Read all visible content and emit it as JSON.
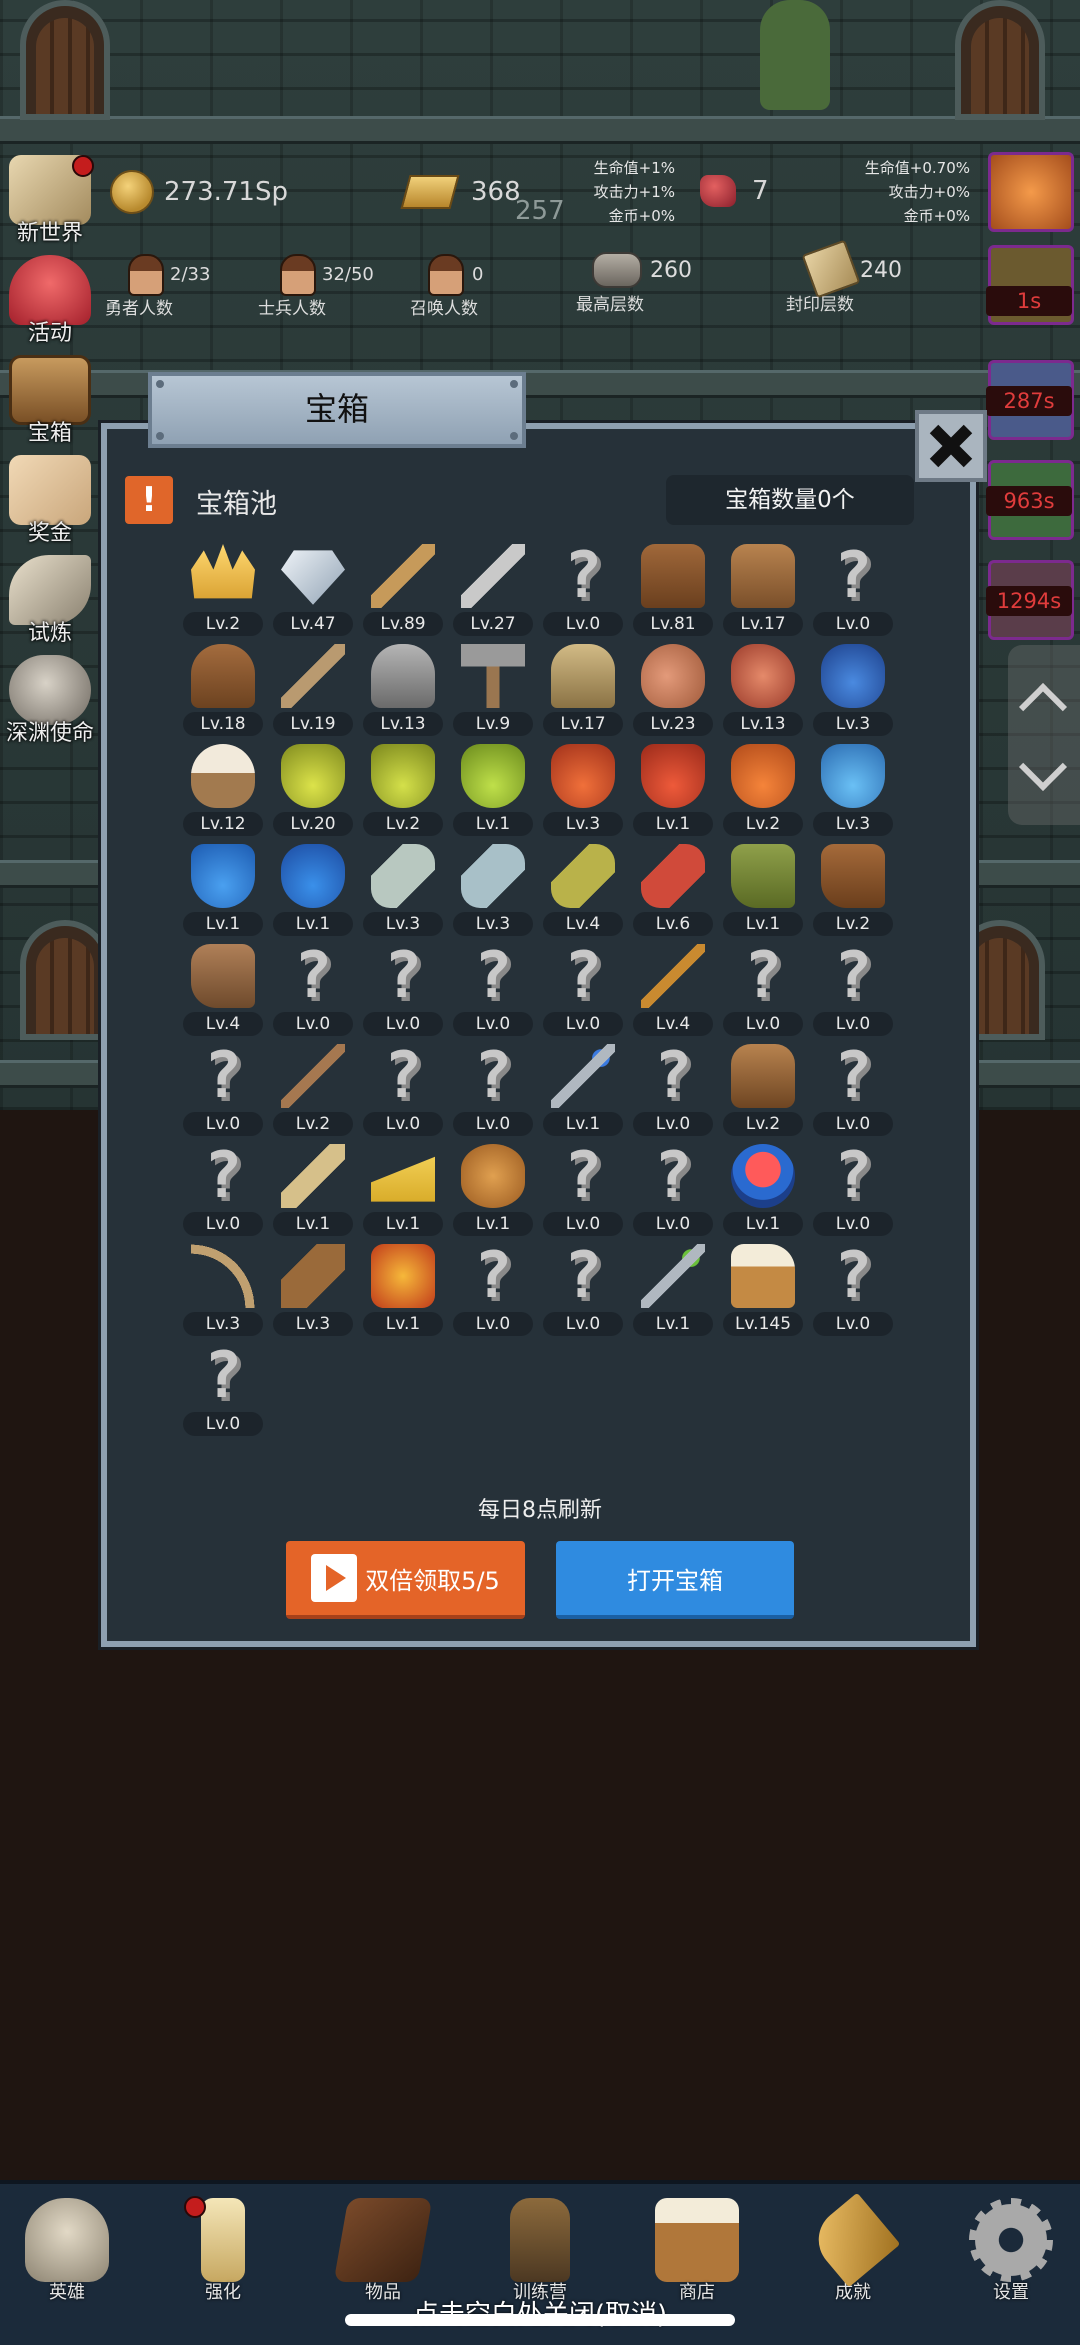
{
  "colors": {
    "modal_bg": "#263139",
    "modal_border": "#8ea0b0",
    "orange_button": "#e46428",
    "blue_button": "#2f8be0",
    "timer_text": "#e03c3c"
  },
  "hud": {
    "gold": "273.71Sp",
    "bars": "368",
    "bars_sub": "257",
    "gems": "7",
    "bonus_left": [
      "生命值+1%",
      "攻击力+1%",
      "金币+0%"
    ],
    "bonus_right": [
      "生命值+0.70%",
      "攻击力+0%",
      "金币+0%"
    ],
    "heroes": {
      "value": "2/33",
      "label": "勇者人数"
    },
    "soldiers": {
      "value": "32/50",
      "label": "士兵人数"
    },
    "summons": {
      "value": "0",
      "label": "召唤人数"
    },
    "max_floor": {
      "value": "260",
      "label": "最高层数"
    },
    "sealed_floor": {
      "value": "240",
      "label": "封印层数"
    }
  },
  "side_menu": [
    {
      "label": "新世界",
      "icon": "map-icon"
    },
    {
      "label": "活动",
      "icon": "heart-icon"
    },
    {
      "label": "宝箱",
      "icon": "chest-icon"
    },
    {
      "label": "奖金",
      "icon": "envelope-icon"
    },
    {
      "label": "试炼",
      "icon": "feather-icon"
    },
    {
      "label": "深渊使命",
      "icon": "orb-icon"
    }
  ],
  "right_timers": [
    "1s",
    "287s",
    "963s",
    "1294s"
  ],
  "modal": {
    "title": "宝箱",
    "warning": "!",
    "pool_title": "宝箱池",
    "chest_count": "宝箱数量0个",
    "refresh_note": "每日8点刷新",
    "double_button": "双倍领取5/5",
    "open_button": "打开宝箱"
  },
  "items": [
    {
      "icon": "crown-icon",
      "level": "Lv.2"
    },
    {
      "icon": "diamond-icon",
      "level": "Lv.47"
    },
    {
      "icon": "bronze-sword-icon",
      "level": "Lv.89"
    },
    {
      "icon": "silver-sword-icon",
      "level": "Lv.27"
    },
    {
      "icon": "unknown-icon",
      "level": "Lv.0"
    },
    {
      "icon": "leather-armor-icon",
      "level": "Lv.81"
    },
    {
      "icon": "backpack-icon",
      "level": "Lv.17"
    },
    {
      "icon": "unknown-icon",
      "level": "Lv.0"
    },
    {
      "icon": "leather-helmet-icon",
      "level": "Lv.18"
    },
    {
      "icon": "dagger-icon",
      "level": "Lv.19"
    },
    {
      "icon": "knight-helmet-icon",
      "level": "Lv.13"
    },
    {
      "icon": "hammer-icon",
      "level": "Lv.9"
    },
    {
      "icon": "great-helm-icon",
      "level": "Lv.17"
    },
    {
      "icon": "ham-icon",
      "level": "Lv.23"
    },
    {
      "icon": "steak-icon",
      "level": "Lv.13"
    },
    {
      "icon": "blue-pot-icon",
      "level": "Lv.3"
    },
    {
      "icon": "flour-bowl-icon",
      "level": "Lv.12"
    },
    {
      "icon": "yellow-potion-icon",
      "level": "Lv.20"
    },
    {
      "icon": "yellow-flask-icon",
      "level": "Lv.2"
    },
    {
      "icon": "green-potion-icon",
      "level": "Lv.1"
    },
    {
      "icon": "red-potion-icon",
      "level": "Lv.3"
    },
    {
      "icon": "red-flask-icon",
      "level": "Lv.1"
    },
    {
      "icon": "orange-potion-icon",
      "level": "Lv.2"
    },
    {
      "icon": "blue-vial-icon",
      "level": "Lv.3"
    },
    {
      "icon": "blue-flask-icon",
      "level": "Lv.1"
    },
    {
      "icon": "blue-potion-icon",
      "level": "Lv.1"
    },
    {
      "icon": "grey-vial-icon",
      "level": "Lv.3"
    },
    {
      "icon": "silver-vial-icon",
      "level": "Lv.3"
    },
    {
      "icon": "olive-bottle-icon",
      "level": "Lv.4"
    },
    {
      "icon": "red-bottle-icon",
      "level": "Lv.6"
    },
    {
      "icon": "winged-boot-icon",
      "level": "Lv.1"
    },
    {
      "icon": "leather-boot-icon",
      "level": "Lv.2"
    },
    {
      "icon": "leather-shoe-icon",
      "level": "Lv.4"
    },
    {
      "icon": "unknown-icon",
      "level": "Lv.0"
    },
    {
      "icon": "unknown-icon",
      "level": "Lv.0"
    },
    {
      "icon": "unknown-icon",
      "level": "Lv.0"
    },
    {
      "icon": "unknown-icon",
      "level": "Lv.0"
    },
    {
      "icon": "torch-staff-icon",
      "level": "Lv.4"
    },
    {
      "icon": "unknown-icon",
      "level": "Lv.0"
    },
    {
      "icon": "unknown-icon",
      "level": "Lv.0"
    },
    {
      "icon": "unknown-icon",
      "level": "Lv.0"
    },
    {
      "icon": "wooden-staff-icon",
      "level": "Lv.2"
    },
    {
      "icon": "unknown-icon",
      "level": "Lv.0"
    },
    {
      "icon": "unknown-icon",
      "level": "Lv.0"
    },
    {
      "icon": "blue-wand-icon",
      "level": "Lv.1"
    },
    {
      "icon": "unknown-icon",
      "level": "Lv.0"
    },
    {
      "icon": "big-backpack-icon",
      "level": "Lv.2"
    },
    {
      "icon": "unknown-icon",
      "level": "Lv.0"
    },
    {
      "icon": "unknown-icon",
      "level": "Lv.0"
    },
    {
      "icon": "club-icon",
      "level": "Lv.1"
    },
    {
      "icon": "cheese-icon",
      "level": "Lv.1"
    },
    {
      "icon": "pie-icon",
      "level": "Lv.1"
    },
    {
      "icon": "unknown-icon",
      "level": "Lv.0"
    },
    {
      "icon": "unknown-icon",
      "level": "Lv.0"
    },
    {
      "icon": "red-orb-icon",
      "level": "Lv.1"
    },
    {
      "icon": "unknown-icon",
      "level": "Lv.0"
    },
    {
      "icon": "bow-icon",
      "level": "Lv.3"
    },
    {
      "icon": "quiver-icon",
      "level": "Lv.3"
    },
    {
      "icon": "fire-scroll-icon",
      "level": "Lv.1"
    },
    {
      "icon": "unknown-icon",
      "level": "Lv.0"
    },
    {
      "icon": "unknown-icon",
      "level": "Lv.0"
    },
    {
      "icon": "green-wand-icon",
      "level": "Lv.1"
    },
    {
      "icon": "beer-mug-icon",
      "level": "Lv.145"
    },
    {
      "icon": "unknown-icon",
      "level": "Lv.0"
    },
    {
      "icon": "unknown-icon",
      "level": "Lv.0"
    }
  ],
  "bottom_nav": [
    {
      "label": "英雄",
      "icon": "skull-icon"
    },
    {
      "label": "强化",
      "icon": "candle-icon"
    },
    {
      "label": "物品",
      "icon": "book-icon"
    },
    {
      "label": "训练营",
      "icon": "lantern-icon"
    },
    {
      "label": "商店",
      "icon": "mug-icon"
    },
    {
      "label": "成就",
      "icon": "key-icon"
    },
    {
      "label": "设置",
      "icon": "gear-icon"
    }
  ],
  "close_hint": "点击空白处关闭(取消)"
}
